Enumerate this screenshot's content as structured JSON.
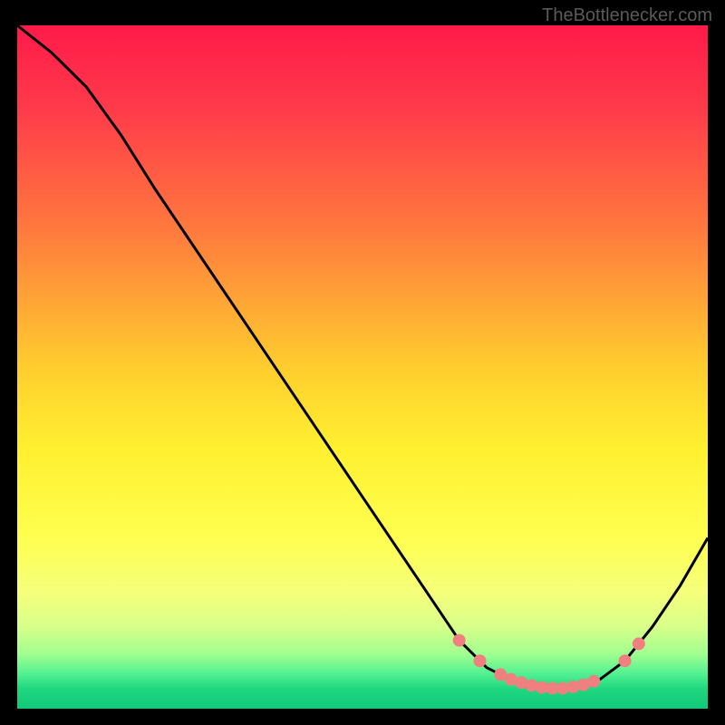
{
  "attribution": "TheBottlenecker.com",
  "chart_data": {
    "type": "line",
    "title": "",
    "xlabel": "",
    "ylabel": "",
    "xlim": [
      0,
      100
    ],
    "ylim": [
      0,
      100
    ],
    "gradient_stops": [
      {
        "offset": 0,
        "color": "#ff1a4a"
      },
      {
        "offset": 12,
        "color": "#ff3a4a"
      },
      {
        "offset": 30,
        "color": "#ff7a3e"
      },
      {
        "offset": 50,
        "color": "#ffcd2e"
      },
      {
        "offset": 62,
        "color": "#fff030"
      },
      {
        "offset": 75,
        "color": "#ffff50"
      },
      {
        "offset": 83,
        "color": "#f5ff7a"
      },
      {
        "offset": 88,
        "color": "#d8ff8a"
      },
      {
        "offset": 92,
        "color": "#a0ff90"
      },
      {
        "offset": 95,
        "color": "#50f090"
      },
      {
        "offset": 97,
        "color": "#20d880"
      },
      {
        "offset": 100,
        "color": "#10c878"
      }
    ],
    "series": [
      {
        "name": "bottleneck-curve",
        "points": [
          {
            "x": 0,
            "y": 100
          },
          {
            "x": 5,
            "y": 96
          },
          {
            "x": 10,
            "y": 91
          },
          {
            "x": 15,
            "y": 84
          },
          {
            "x": 20,
            "y": 76
          },
          {
            "x": 30,
            "y": 61
          },
          {
            "x": 40,
            "y": 46
          },
          {
            "x": 50,
            "y": 31
          },
          {
            "x": 58,
            "y": 19
          },
          {
            "x": 64,
            "y": 10
          },
          {
            "x": 68,
            "y": 6
          },
          {
            "x": 72,
            "y": 4
          },
          {
            "x": 76,
            "y": 3
          },
          {
            "x": 80,
            "y": 3
          },
          {
            "x": 84,
            "y": 4
          },
          {
            "x": 88,
            "y": 7
          },
          {
            "x": 92,
            "y": 12
          },
          {
            "x": 96,
            "y": 18
          },
          {
            "x": 100,
            "y": 25
          }
        ]
      }
    ],
    "marker_points": [
      {
        "x": 64,
        "y": 10
      },
      {
        "x": 67,
        "y": 7
      },
      {
        "x": 70,
        "y": 5
      },
      {
        "x": 71.5,
        "y": 4.3
      },
      {
        "x": 73,
        "y": 3.8
      },
      {
        "x": 74.5,
        "y": 3.4
      },
      {
        "x": 76,
        "y": 3.1
      },
      {
        "x": 77.5,
        "y": 3
      },
      {
        "x": 79,
        "y": 3
      },
      {
        "x": 80.5,
        "y": 3.2
      },
      {
        "x": 82,
        "y": 3.5
      },
      {
        "x": 83.5,
        "y": 4
      },
      {
        "x": 88,
        "y": 7
      },
      {
        "x": 90,
        "y": 9.5
      }
    ],
    "marker_color": "#f08080"
  }
}
